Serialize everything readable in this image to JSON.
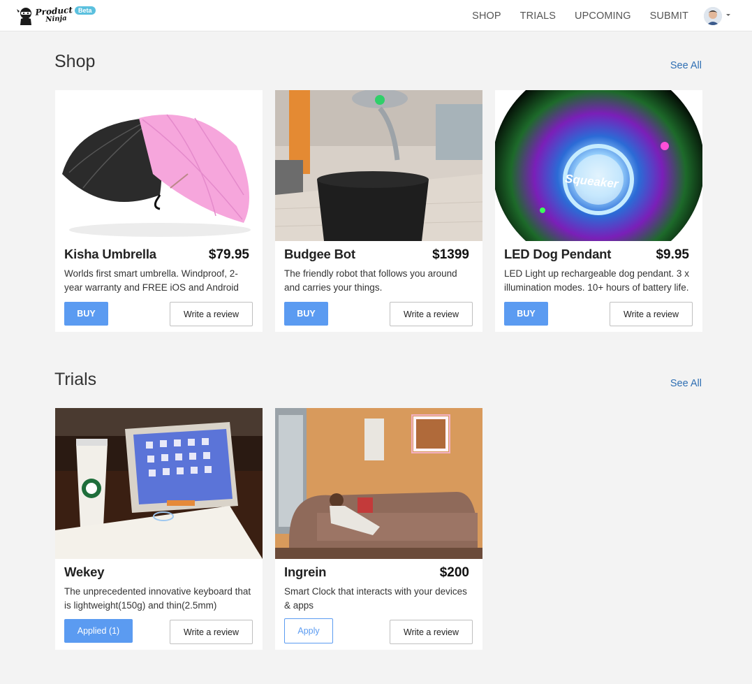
{
  "brand": {
    "logo_line1": "Product",
    "logo_line2": "Ninja",
    "badge": "Beta"
  },
  "nav": {
    "items": [
      "SHOP",
      "TRIALS",
      "UPCOMING",
      "SUBMIT"
    ]
  },
  "shop": {
    "title": "Shop",
    "see_all": "See All",
    "cards": [
      {
        "name": "Kisha Umbrella",
        "price": "$79.95",
        "desc": "Worlds first smart umbrella. Windproof, 2-year warranty and FREE iOS and Android app.",
        "action": "BUY",
        "review": "Write a review"
      },
      {
        "name": "Budgee Bot",
        "price": "$1399",
        "desc": "The friendly robot that follows you around and carries your things.",
        "action": "BUY",
        "review": "Write a review"
      },
      {
        "name": "LED Dog Pendant",
        "price": "$9.95",
        "desc": "LED Light up rechargeable dog pendant. 3 x illumination modes. 10+ hours of battery life.",
        "action": "BUY",
        "review": "Write a review",
        "image_text": "Squeaker"
      }
    ]
  },
  "trials": {
    "title": "Trials",
    "see_all": "See All",
    "cards": [
      {
        "name": "Wekey",
        "price": "",
        "desc": "The unprecedented innovative keyboard that is lightweight(150g) and thin(2.5mm)",
        "action": "Applied (1)",
        "review": "Write a review"
      },
      {
        "name": "Ingrein",
        "price": "$200",
        "desc": "Smart Clock that interacts with your devices & apps",
        "action": "Apply",
        "review": "Write a review"
      }
    ]
  },
  "colors": {
    "accent": "#5b9bf1",
    "link": "#2f6fb3",
    "badge": "#5bc0de",
    "background": "#f3f3f3"
  }
}
